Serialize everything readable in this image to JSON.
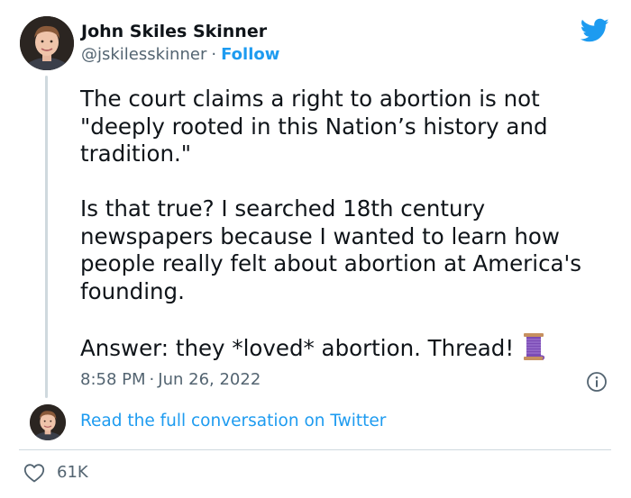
{
  "author": {
    "name": "John Skiles Skinner",
    "handle": "@jskilesskinner",
    "separator": "·",
    "follow_label": "Follow"
  },
  "tweet": {
    "paragraphs": [
      "The court claims a right to abortion is not \"deeply rooted in this Nation’s history and tradition.\"",
      "Is that true? I searched 18th century newspapers because I wanted to learn how people really felt about abortion at America's founding.",
      "Answer: they *loved* abortion. Thread!"
    ],
    "emoji": "thread-spool-emoji",
    "time": "8:58 PM",
    "separator": "·",
    "date": "Jun 26, 2022"
  },
  "conversation_link": "Read the full conversation on Twitter",
  "likes": {
    "count": "61K"
  },
  "colors": {
    "link_blue": "#1d9bf0",
    "text": "#0f1419",
    "secondary": "#536471",
    "divider": "#cfd9de"
  },
  "icons": [
    "twitter-bird-icon",
    "info-icon",
    "heart-icon"
  ]
}
